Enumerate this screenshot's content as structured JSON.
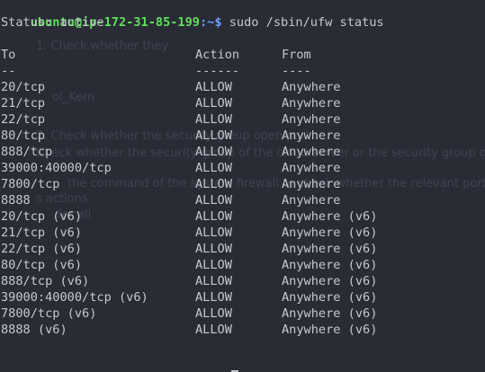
{
  "prompt": {
    "user_host": "ubuntu@ip-172-31-85-199",
    "sep": ":~$"
  },
  "command": " sudo /sbin/ufw status",
  "status_line": "Status: active",
  "table": {
    "headers": [
      "To",
      "Action",
      "From"
    ],
    "dividers": [
      "--",
      "------",
      "----"
    ],
    "rows": [
      [
        "20/tcp",
        "ALLOW",
        "Anywhere"
      ],
      [
        "21/tcp",
        "ALLOW",
        "Anywhere"
      ],
      [
        "22/tcp",
        "ALLOW",
        "Anywhere"
      ],
      [
        "80/tcp",
        "ALLOW",
        "Anywhere"
      ],
      [
        "888/tcp",
        "ALLOW",
        "Anywhere"
      ],
      [
        "39000:40000/tcp",
        "ALLOW",
        "Anywhere"
      ],
      [
        "7800/tcp",
        "ALLOW",
        "Anywhere"
      ],
      [
        "8888",
        "ALLOW",
        "Anywhere"
      ],
      [
        "20/tcp (v6)",
        "ALLOW",
        "Anywhere (v6)"
      ],
      [
        "21/tcp (v6)",
        "ALLOW",
        "Anywhere (v6)"
      ],
      [
        "22/tcp (v6)",
        "ALLOW",
        "Anywhere (v6)"
      ],
      [
        "80/tcp (v6)",
        "ALLOW",
        "Anywhere (v6)"
      ],
      [
        "888/tcp (v6)",
        "ALLOW",
        "Anywhere (v6)"
      ],
      [
        "39000:40000/tcp (v6)",
        "ALLOW",
        "Anywhere (v6)"
      ],
      [
        "7800/tcp (v6)",
        "ALLOW",
        "Anywhere (v6)"
      ],
      [
        "8888 (v6)",
        "ALLOW",
        "Anywhere (v6)"
      ]
    ]
  },
  "ghost_text": {
    "line1": "1. Check whether they",
    "line2": "ol_Kern",
    "line3": "2. Check whether the security group open port",
    "line4": "Check whether the security group of the cloud server or the security group open port 8888",
    "line5": "the command of the system firewall to check whether the relevant port",
    "line6": "s actions",
    "line7": "for all"
  },
  "colors": {
    "background": "#292c35",
    "text": "#c5c8ce",
    "prompt_user": "#5fe05a",
    "prompt_path": "#6aa1ff"
  }
}
